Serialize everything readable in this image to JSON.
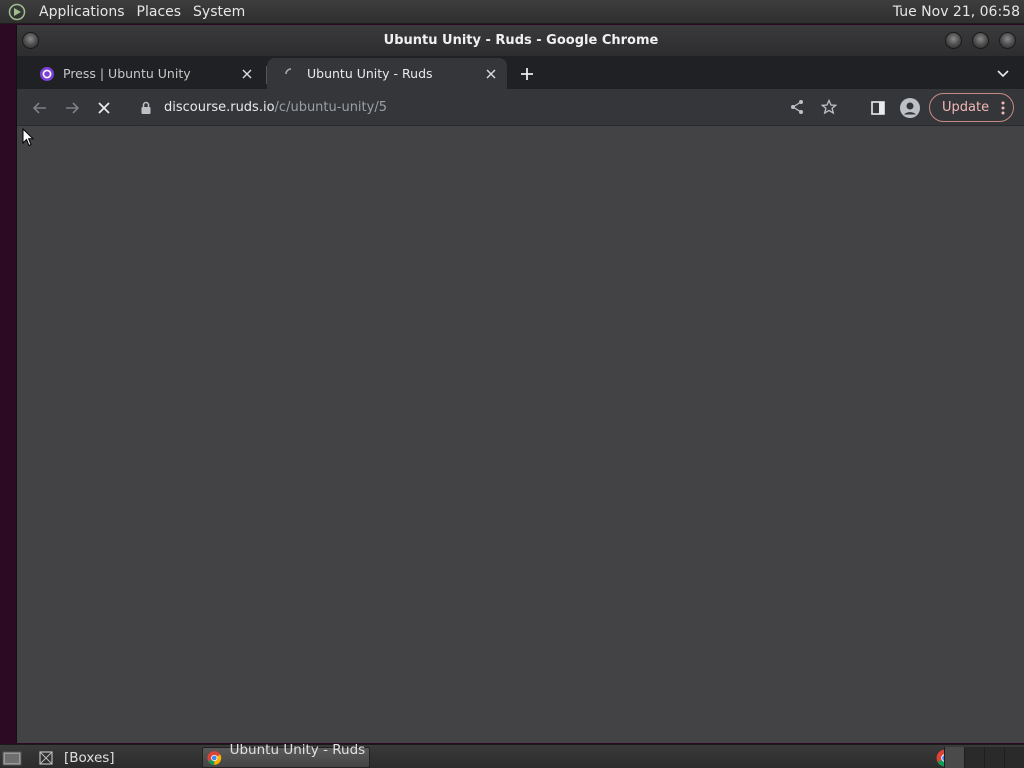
{
  "top_panel": {
    "menus": [
      "Applications",
      "Places",
      "System"
    ],
    "clock": "Tue Nov 21, 06:58"
  },
  "window": {
    "title": "Ubuntu Unity - Ruds - Google Chrome"
  },
  "tabs": [
    {
      "label": "Press | Ubuntu Unity",
      "icon": "ubuntu-unity-favicon",
      "state": "inactive"
    },
    {
      "label": "Ubuntu Unity - Ruds",
      "icon": "loading-spinner-icon",
      "state": "active"
    }
  ],
  "toolbar": {
    "url_host": "discourse.ruds.io",
    "url_path": "/c/ubuntu-unity/5",
    "update_label": "Update"
  },
  "taskbar": {
    "items": [
      {
        "label": "[Boxes]",
        "icon": "boxes-icon"
      },
      {
        "label": "Ubuntu Unity - Ruds ...",
        "icon": "chrome-icon"
      }
    ]
  },
  "colors": {
    "accent_purple": "#7b3fd6",
    "update_red": "#f2b8b5",
    "content_bg": "#434346"
  }
}
